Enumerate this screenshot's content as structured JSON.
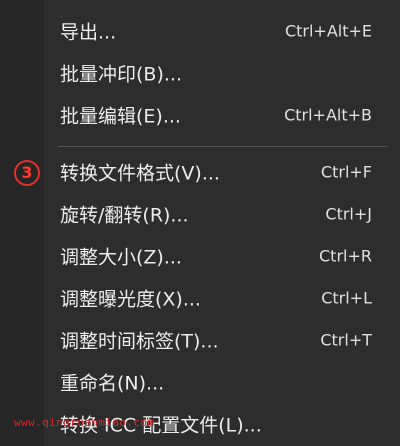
{
  "menu": {
    "step_badge": "3",
    "watermark": "www.qingruanmiao.com",
    "items": [
      {
        "label": "导出...",
        "shortcut": "Ctrl+Alt+E"
      },
      {
        "label": "批量冲印(B)...",
        "shortcut": ""
      },
      {
        "label": "批量编辑(E)...",
        "shortcut": "Ctrl+Alt+B"
      },
      {
        "label": "转换文件格式(V)...",
        "shortcut": "Ctrl+F"
      },
      {
        "label": "旋转/翻转(R)...",
        "shortcut": "Ctrl+J"
      },
      {
        "label": "调整大小(Z)...",
        "shortcut": "Ctrl+R"
      },
      {
        "label": "调整曝光度(X)...",
        "shortcut": "Ctrl+L"
      },
      {
        "label": "调整时间标签(T)...",
        "shortcut": "Ctrl+T"
      },
      {
        "label": "重命名(N)...",
        "shortcut": ""
      },
      {
        "label": "转换 ICC 配置文件(L)...",
        "shortcut": ""
      }
    ]
  }
}
